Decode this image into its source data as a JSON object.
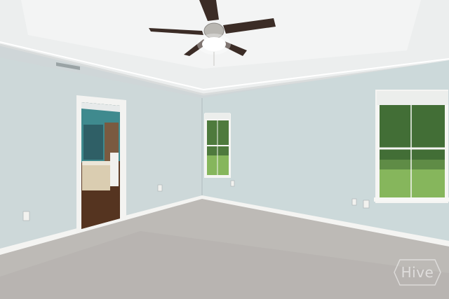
{
  "photo": {
    "subject": "empty-bedroom",
    "watermark_text": "Hive",
    "colors": {
      "wall": "#cdd9da",
      "wall_shadow": "#bfcdcf",
      "ceiling": "#eceeee",
      "carpet": "#bfbcb8",
      "trim": "#f4f4f2",
      "hall_floor": "#5a3a24",
      "bathroom_wall": "#3f8b8e",
      "vanity": "#d9ccb0",
      "lawn": "#86b85c",
      "trees": "#3f6a34",
      "fan_blade": "#3b2c26"
    }
  }
}
